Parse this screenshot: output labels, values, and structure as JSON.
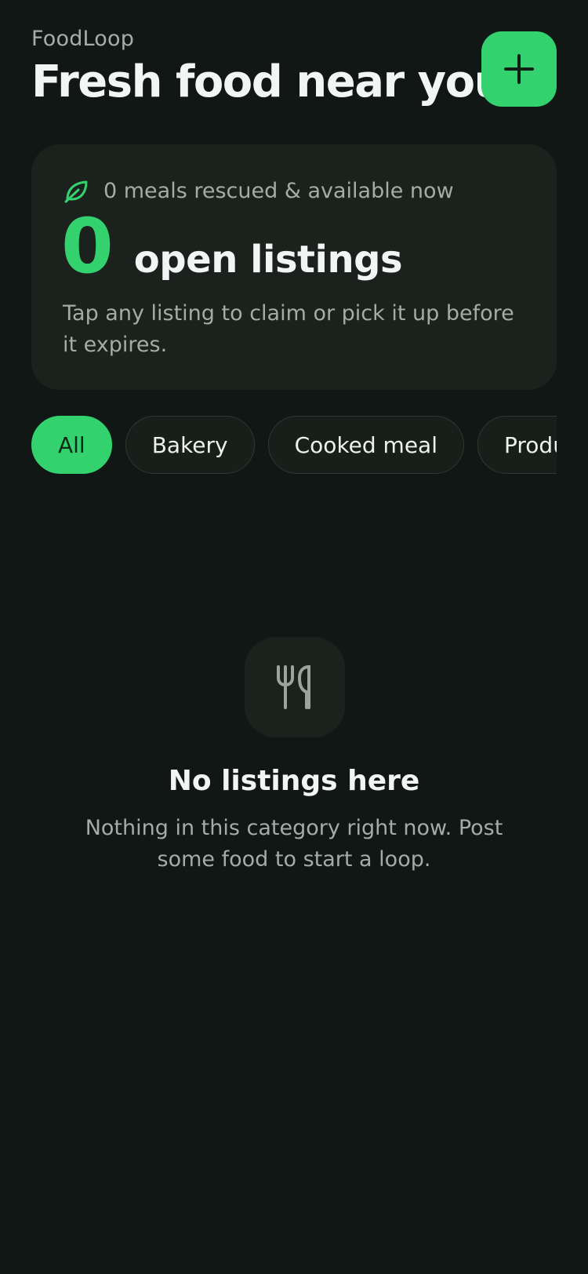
{
  "header": {
    "app_name": "FoodLoop",
    "title": "Fresh food near you",
    "add_icon": "plus-icon"
  },
  "summary": {
    "icon": "leaf-icon",
    "rescued_text": "0 meals rescued & available now",
    "count": "0",
    "count_label": "open listings",
    "hint": "Tap any listing to claim or pick it up before it expires."
  },
  "categories": [
    {
      "label": "All",
      "active": true
    },
    {
      "label": "Bakery",
      "active": false
    },
    {
      "label": "Cooked meal",
      "active": false
    },
    {
      "label": "Produce",
      "active": false
    }
  ],
  "empty_state": {
    "icon": "utensils-icon",
    "title": "No listings here",
    "description": "Nothing in this category right now. Post some food to start a loop."
  },
  "colors": {
    "background": "#111714",
    "card": "#1b221e",
    "accent": "#33d26f",
    "muted_text": "#a4aca7"
  }
}
